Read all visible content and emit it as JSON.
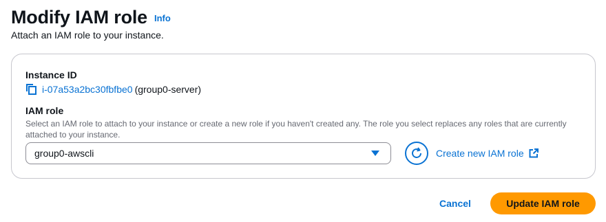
{
  "header": {
    "title": "Modify IAM role",
    "info_label": "Info",
    "subtitle": "Attach an IAM role to your instance."
  },
  "instance": {
    "label": "Instance ID",
    "id": "i-07a53a2bc30fbfbe0",
    "name": "(group0-server)",
    "copy_icon": "copy-icon"
  },
  "iam_role": {
    "label": "IAM role",
    "description": "Select an IAM role to attach to your instance or create a new role if you haven't created any. The role you select replaces any roles that are currently attached to your instance.",
    "selected_value": "group0-awscli",
    "refresh_icon": "refresh-icon",
    "create_link_label": "Create new IAM role",
    "external_icon": "external-link-icon"
  },
  "footer": {
    "cancel_label": "Cancel",
    "submit_label": "Update IAM role"
  },
  "colors": {
    "link": "#0972d3",
    "primary": "#ff9900",
    "text": "#0f141a",
    "muted": "#656871",
    "border": "#c6c6cd"
  }
}
